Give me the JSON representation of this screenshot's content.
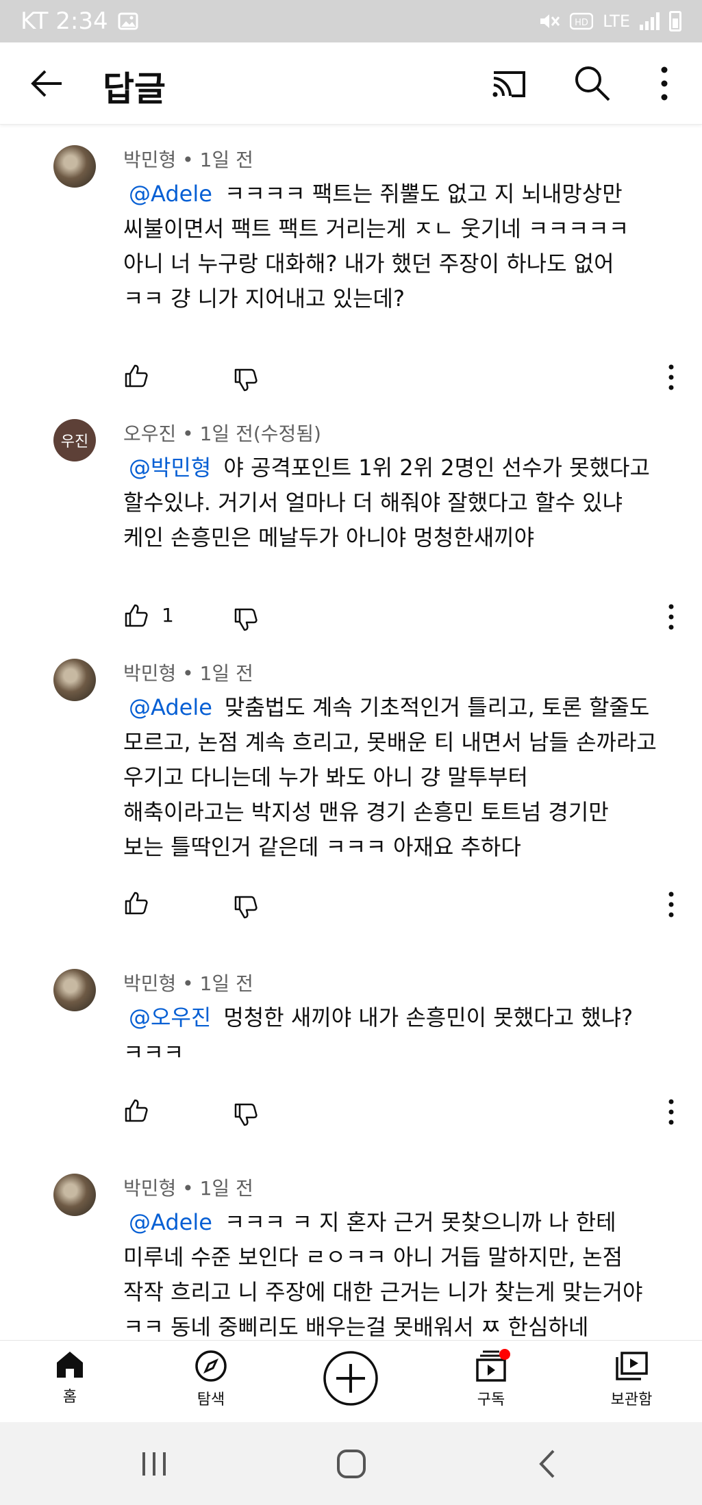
{
  "status_bar": {
    "carrier_time": "KT 2:34",
    "network": "LTE"
  },
  "header": {
    "title": "답글"
  },
  "comments": [
    {
      "author": "박민형",
      "time": "1일 전",
      "mention": "@Adele",
      "lines": [
        "ㅋㅋㅋㅋ 팩트는 쥐뿔도 없고 지 뇌내망상만",
        "씨불이면서 팩트 팩트 거리는게 ㅈㄴ 웃기네 ㅋㅋㅋㅋㅋ",
        "아니 너 누구랑 대화해? 내가 했던 주장이 하나도 없어",
        "ㅋㅋ 걍 니가 지어내고 있는데?"
      ],
      "likes": ""
    },
    {
      "author": "오우진",
      "time": "1일 전(수정됨)",
      "avatar_text": "우진",
      "mention": "@박민형",
      "lines": [
        "야 공격포인트 1위 2위 2명인 선수가 못했다고",
        "할수있냐. 거기서 얼마나 더 해줘야 잘했다고 할수 있냐",
        "케인 손흥민은 메날두가 아니야 멍청한새끼야"
      ],
      "likes": "1"
    },
    {
      "author": "박민형",
      "time": "1일 전",
      "mention": "@Adele",
      "lines": [
        "맞춤법도 계속 기초적인거 틀리고, 토론 할줄도",
        "모르고, 논점 계속 흐리고, 못배운 티 내면서 남들 손까라고",
        "우기고 다니는데 누가 봐도 아니 걍 말투부터",
        "해축이라고는 박지성 맨유 경기 손흥민 토트넘 경기만",
        "보는 틀딱인거 같은데 ㅋㅋㅋ  아재요 추하다"
      ],
      "likes": ""
    },
    {
      "author": "박민형",
      "time": "1일 전",
      "mention": "@오우진",
      "lines": [
        "멍청한 새끼야 내가 손흥민이 못했다고 했냐?",
        "ㅋㅋㅋ"
      ],
      "likes": ""
    },
    {
      "author": "박민형",
      "time": "1일 전",
      "mention": "@Adele",
      "lines": [
        "ㅋㅋㅋ ㅋ 지 혼자 근거 못찾으니까 나 한테",
        "미루네 수준 보인다 ㄹㅇㅋㅋ 아니 거듭 말하지만, 논점",
        "작작 흐리고 니 주장에 대한 근거는 니가 찾는게 맞는거야",
        "ㅋㅋ 동네 중삐리도 배우는걸 못배워서 ㅉ 한심하네"
      ],
      "likes": ""
    }
  ],
  "bottom_nav": {
    "home": "홈",
    "explore": "탐색",
    "subscriptions": "구독",
    "library": "보관함"
  },
  "colors": {
    "mention": "#065fd4",
    "meta": "#606060",
    "status_bar": "#d3d3d3",
    "notification_dot": "#ff0000"
  }
}
